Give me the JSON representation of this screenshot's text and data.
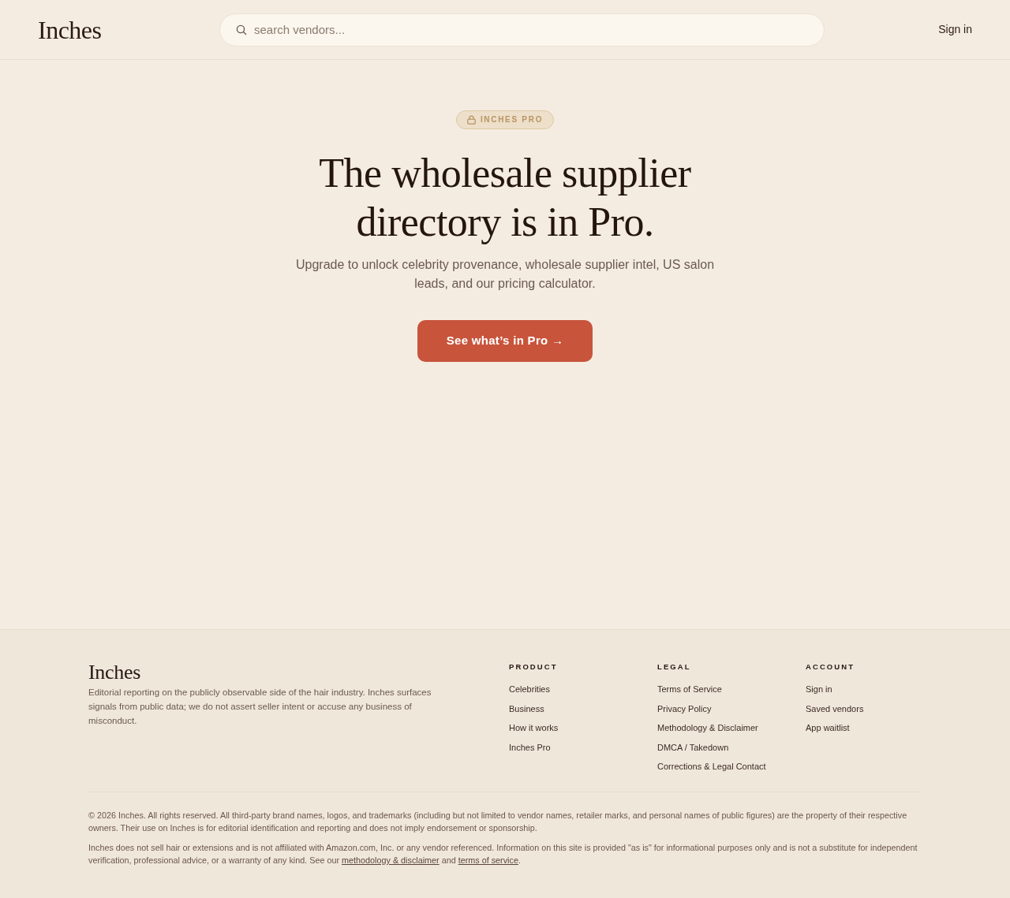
{
  "header": {
    "logo": "Inches",
    "search": {
      "placeholder": "search vendors..."
    },
    "sign_in": "Sign in"
  },
  "hero": {
    "badge": "INCHES PRO",
    "title": "The wholesale supplier directory is in Pro.",
    "description": "Upgrade to unlock celebrity provenance, wholesale supplier intel, US salon leads, and our pricing calculator.",
    "cta": "See what’s in Pro →"
  },
  "footer": {
    "brand": "Inches",
    "tagline": "Editorial reporting on the publicly observable side of the hair industry. Inches surfaces signals from public data; we do not assert seller intent or accuse any business of misconduct.",
    "columns": [
      {
        "heading": "PRODUCT",
        "links": [
          "Celebrities",
          "Business",
          "How it works",
          "Inches Pro"
        ]
      },
      {
        "heading": "LEGAL",
        "links": [
          "Terms of Service",
          "Privacy Policy",
          "Methodology & Disclaimer",
          "DMCA / Takedown",
          "Corrections & Legal Contact"
        ]
      },
      {
        "heading": "ACCOUNT",
        "links": [
          "Sign in",
          "Saved vendors",
          "App waitlist"
        ]
      }
    ],
    "copyright": "© 2026 Inches. All rights reserved. All third-party brand names, logos, and trademarks (including but not limited to vendor names, retailer marks, and personal names of public figures) are the property of their respective owners. Their use on Inches is for editorial identification and reporting and does not imply endorsement or sponsorship.",
    "notice": [
      {
        "kind": "text",
        "text": "Inches does not sell hair or extensions and is not affiliated with Amazon.com, Inc. or any vendor referenced. Information on this site is provided \"as is\" for informational purposes only and is not a substitute for independent verification, professional advice, or a warranty of any kind. See our "
      },
      {
        "kind": "link",
        "text": "methodology & disclaimer"
      },
      {
        "kind": "text",
        "text": " and "
      },
      {
        "kind": "link",
        "text": "terms of service"
      },
      {
        "kind": "text",
        "text": "."
      }
    ]
  }
}
